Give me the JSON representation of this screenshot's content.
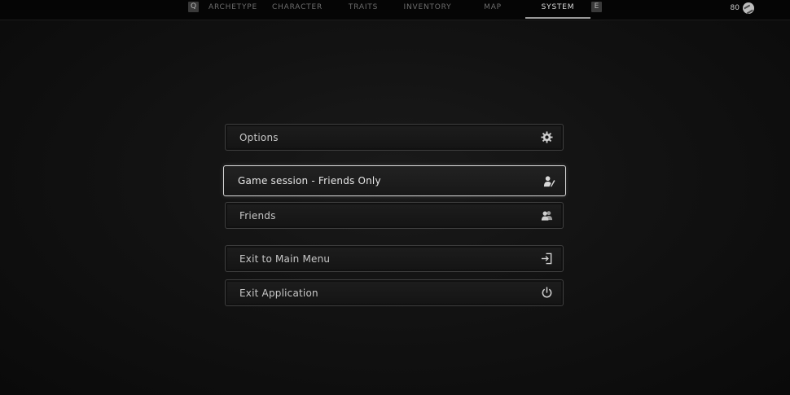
{
  "topbar": {
    "left_key": "Q",
    "right_key": "E",
    "tabs": [
      {
        "label": "ARCHETYPE"
      },
      {
        "label": "CHARACTER"
      },
      {
        "label": "TRAITS"
      },
      {
        "label": "INVENTORY"
      },
      {
        "label": "MAP"
      },
      {
        "label": "SYSTEM"
      }
    ],
    "active_tab": "SYSTEM",
    "currency": {
      "value": "80",
      "icon": "currency-icon"
    }
  },
  "menu": {
    "items": [
      {
        "label": "Options",
        "icon": "gear-icon"
      },
      {
        "label": "Game session - Friends Only",
        "icon": "session-user-icon",
        "selected": true
      },
      {
        "label": "Friends",
        "icon": "friends-icon"
      },
      {
        "label": "Exit to Main Menu",
        "icon": "exit-door-icon"
      },
      {
        "label": "Exit Application",
        "icon": "power-icon"
      }
    ]
  }
}
